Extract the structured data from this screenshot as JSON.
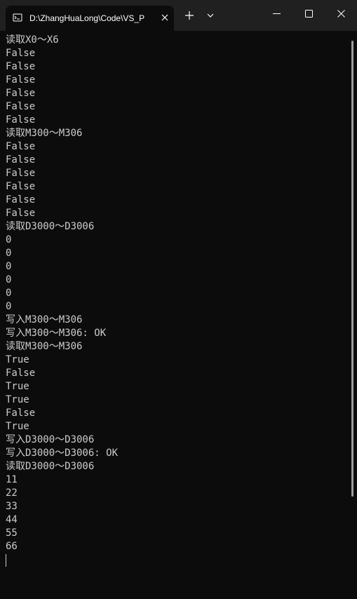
{
  "window": {
    "tab_title": "D:\\ZhangHuaLong\\Code\\VS_P",
    "icons": {
      "tab": "terminal-icon",
      "tab_close": "close-icon",
      "new_tab": "plus-icon",
      "dropdown": "chevron-down-icon",
      "minimize": "minimize-icon",
      "maximize": "maximize-icon",
      "close": "close-icon"
    }
  },
  "console": {
    "lines": [
      "读取X0～X6",
      "False",
      "False",
      "False",
      "False",
      "False",
      "False",
      "读取M300～M306",
      "False",
      "False",
      "False",
      "False",
      "False",
      "False",
      "读取D3000～D3006",
      "0",
      "0",
      "0",
      "0",
      "0",
      "0",
      "写入M300～M306",
      "写入M300～M306: OK",
      "读取M300～M306",
      "True",
      "False",
      "True",
      "True",
      "False",
      "True",
      "写入D3000～D3006",
      "写入D3000～D3006: OK",
      "读取D3000～D3006",
      "11",
      "22",
      "33",
      "44",
      "55",
      "66"
    ]
  },
  "colors": {
    "background": "#0c0c0c",
    "titlebar": "#202020",
    "text": "#cccccc"
  }
}
